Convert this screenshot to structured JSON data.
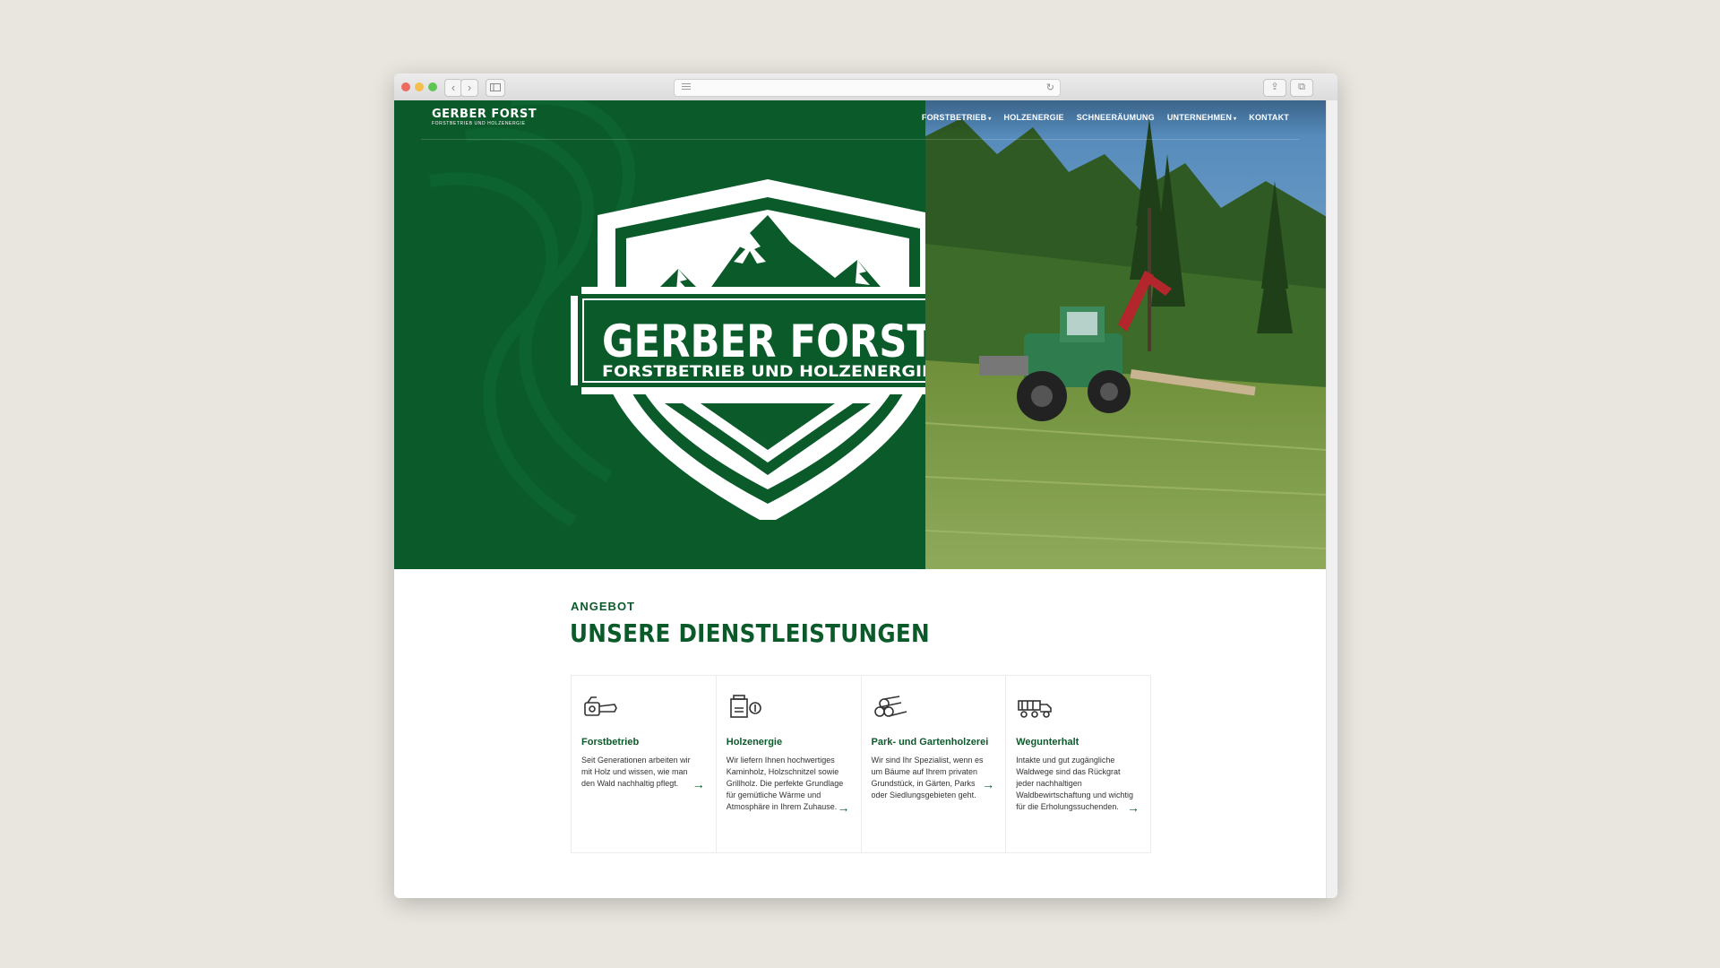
{
  "brand": {
    "name": "GERBER FORST",
    "tagline": "FORSTBETRIEB UND HOLZENERGIE"
  },
  "nav": [
    {
      "label": "FORSTBETRIEB",
      "has_dropdown": true
    },
    {
      "label": "HOLZENERGIE",
      "has_dropdown": false
    },
    {
      "label": "SCHNEERÄUMUNG",
      "has_dropdown": false
    },
    {
      "label": "UNTERNEHMEN",
      "has_dropdown": true
    },
    {
      "label": "KONTAKT",
      "has_dropdown": false
    }
  ],
  "section": {
    "eyebrow": "ANGEBOT",
    "title": "UNSERE DIENSTLEISTUNGEN"
  },
  "services": [
    {
      "icon": "chainsaw-icon",
      "title": "Forstbetrieb",
      "text": "Seit Generationen arbeiten wir mit Holz und wissen, wie man den Wald nachhaltig pflegt.",
      "arrow": "→"
    },
    {
      "icon": "wood-stove-icon",
      "title": "Holzenergie",
      "text": "Wir liefern Ihnen hochwertiges Kaminholz, Holzschnitzel sowie Grillholz. Die perfekte Grundlage für gemütliche Wärme und Atmosphäre in Ihrem Zuhause.",
      "arrow": "→"
    },
    {
      "icon": "log-pile-icon",
      "title": "Park- und Gartenholzerei",
      "text": "Wir sind Ihr Spezialist, wenn es um Bäume auf Ihrem privaten Grundstück, in Gärten, Parks oder Siedlungsgebieten geht.",
      "arrow": "→"
    },
    {
      "icon": "log-truck-icon",
      "title": "Wegunterhalt",
      "text": "Intakte und gut zugängliche Waldwege sind das Rückgrat jeder nachhaltigen Waldbewirtschaftung und wichtig für die Erholungssuchenden.",
      "arrow": "→"
    }
  ],
  "colors": {
    "brand_green": "#0b5a2a",
    "background": "#e9e5df"
  }
}
